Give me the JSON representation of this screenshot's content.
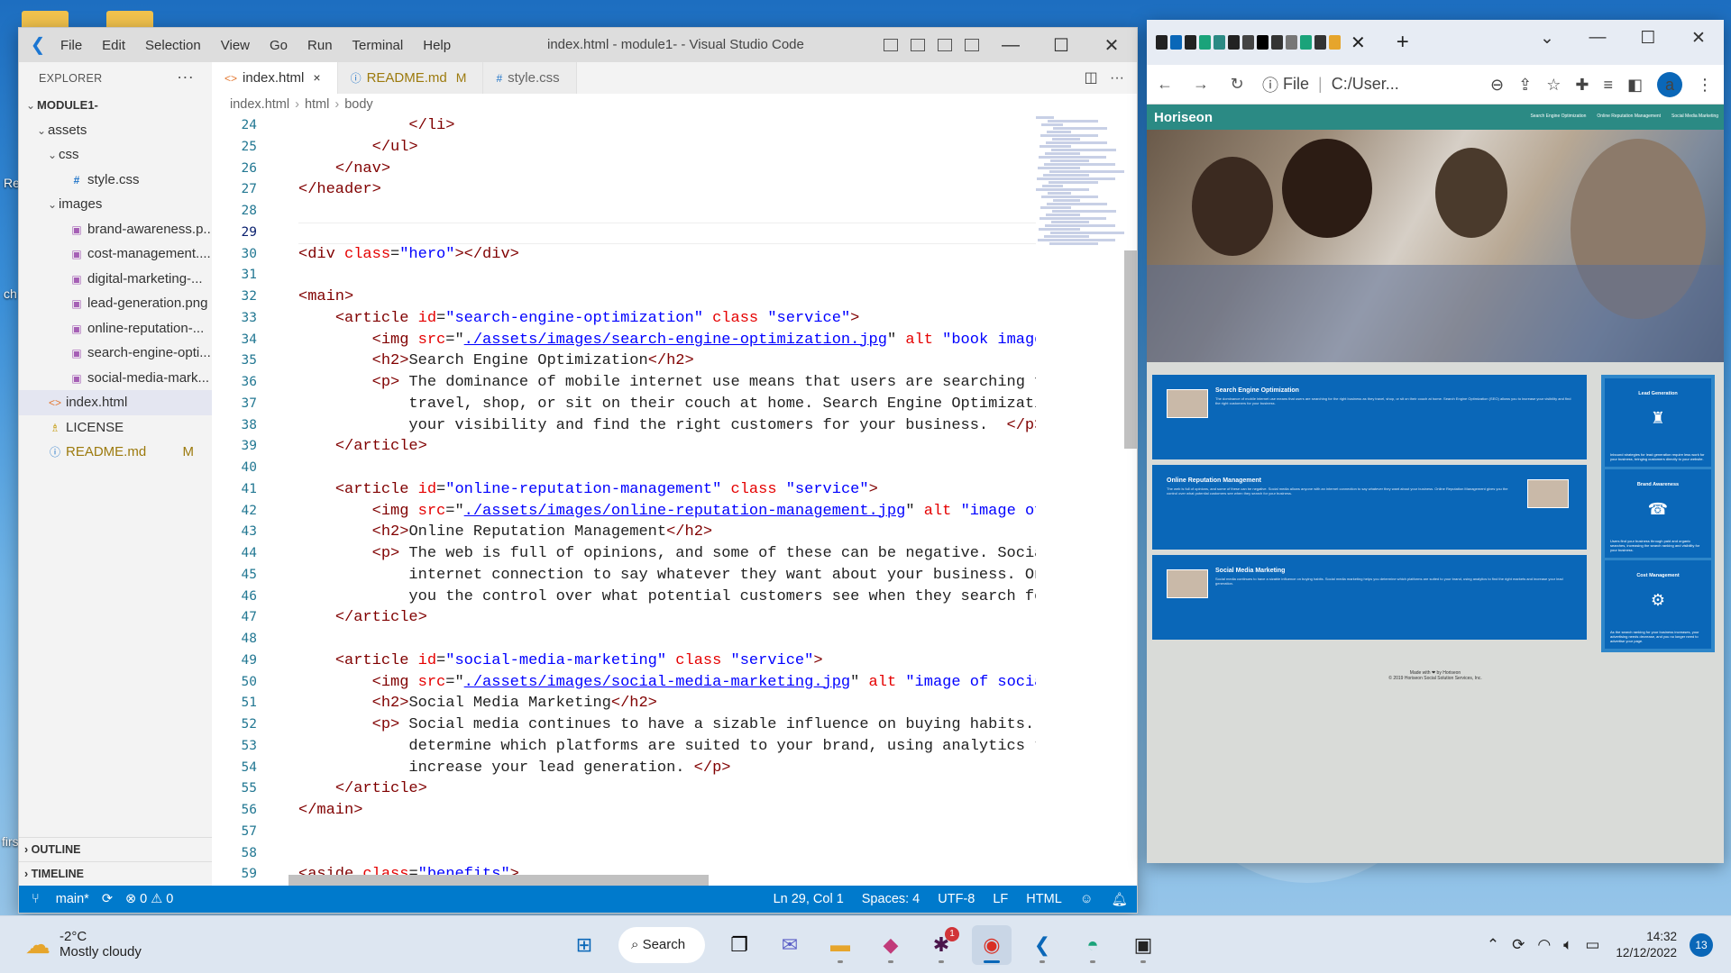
{
  "desktop": {
    "side_texts": [
      "Re",
      "ch",
      "firs"
    ]
  },
  "vscode": {
    "menu": [
      "File",
      "Edit",
      "Selection",
      "View",
      "Go",
      "Run",
      "Terminal",
      "Help"
    ],
    "window_title": "index.html - module1- - Visual Studio Code",
    "explorer_label": "EXPLORER",
    "tree": [
      {
        "label": "MODULE1-",
        "depth": 0,
        "twisty": "⌄",
        "icon": "",
        "kind": "root"
      },
      {
        "label": "assets",
        "depth": 1,
        "twisty": "⌄",
        "icon": "",
        "kind": "folder"
      },
      {
        "label": "css",
        "depth": 2,
        "twisty": "⌄",
        "icon": "",
        "kind": "folder"
      },
      {
        "label": "style.css",
        "depth": 3,
        "twisty": "",
        "icon": "#",
        "kind": "css"
      },
      {
        "label": "images",
        "depth": 2,
        "twisty": "⌄",
        "icon": "",
        "kind": "folder"
      },
      {
        "label": "brand-awareness.p...",
        "depth": 3,
        "twisty": "",
        "icon": "▣",
        "kind": "img"
      },
      {
        "label": "cost-management....",
        "depth": 3,
        "twisty": "",
        "icon": "▣",
        "kind": "img"
      },
      {
        "label": "digital-marketing-...",
        "depth": 3,
        "twisty": "",
        "icon": "▣",
        "kind": "img"
      },
      {
        "label": "lead-generation.png",
        "depth": 3,
        "twisty": "",
        "icon": "▣",
        "kind": "img"
      },
      {
        "label": "online-reputation-...",
        "depth": 3,
        "twisty": "",
        "icon": "▣",
        "kind": "img"
      },
      {
        "label": "search-engine-opti...",
        "depth": 3,
        "twisty": "",
        "icon": "▣",
        "kind": "img"
      },
      {
        "label": "social-media-mark...",
        "depth": 3,
        "twisty": "",
        "icon": "▣",
        "kind": "img"
      },
      {
        "label": "index.html",
        "depth": 1,
        "twisty": "",
        "icon": "<>",
        "kind": "html",
        "selected": true
      },
      {
        "label": "LICENSE",
        "depth": 1,
        "twisty": "",
        "icon": "♗",
        "kind": "lic"
      },
      {
        "label": "README.md",
        "depth": 1,
        "twisty": "",
        "icon": "ⓘ",
        "kind": "info",
        "badge": "M"
      }
    ],
    "outline_label": "OUTLINE",
    "timeline_label": "TIMELINE",
    "tabs": [
      {
        "label": "index.html",
        "icon": "<>",
        "close": "×",
        "active": true
      },
      {
        "label": "README.md",
        "icon": "ⓘ",
        "badge": "M",
        "active": false
      },
      {
        "label": "style.css",
        "icon": "#",
        "active": false
      }
    ],
    "breadcrumb": [
      "index.html",
      "html",
      "body"
    ],
    "line_numbers": [
      "24",
      "25",
      "26",
      "27",
      "28",
      "29",
      "30",
      "31",
      "32",
      "33",
      "34",
      "35",
      "36",
      "37",
      "38",
      "39",
      "40",
      "41",
      "42",
      "43",
      "44",
      "45",
      "46",
      "47",
      "48",
      "49",
      "50",
      "51",
      "52",
      "53",
      "54",
      "55",
      "56",
      "57",
      "58",
      "59"
    ],
    "current_line": "29",
    "code_lines": [
      [
        [
          "            ",
          ""
        ],
        [
          "</li>",
          "t"
        ]
      ],
      [
        [
          "        ",
          ""
        ],
        [
          "</ul>",
          "t"
        ]
      ],
      [
        [
          "    ",
          ""
        ],
        [
          "</nav>",
          "t"
        ]
      ],
      [
        [
          "",
          ""
        ],
        [
          "</header>",
          "t"
        ]
      ],
      [
        [
          "",
          ""
        ]
      ],
      [
        [
          "",
          ""
        ]
      ],
      [
        [
          "",
          ""
        ],
        [
          "<div ",
          "t"
        ],
        [
          "class",
          "a"
        ],
        [
          "=",
          ""
        ],
        [
          "\"hero\"",
          "s"
        ],
        [
          "></div>",
          "t"
        ]
      ],
      [
        [
          "",
          ""
        ]
      ],
      [
        [
          "",
          ""
        ],
        [
          "<main>",
          "t"
        ]
      ],
      [
        [
          "    ",
          ""
        ],
        [
          "<article ",
          "t"
        ],
        [
          "id",
          "a"
        ],
        [
          "=",
          ""
        ],
        [
          "\"search-engine-optimization\"",
          "s"
        ],
        [
          " ",
          ""
        ],
        [
          "class",
          "a"
        ],
        [
          " ",
          ""
        ],
        [
          "\"service\"",
          "s"
        ],
        [
          ">",
          "t"
        ]
      ],
      [
        [
          "        ",
          ""
        ],
        [
          "<img ",
          "t"
        ],
        [
          "src",
          "a"
        ],
        [
          "=\"",
          ""
        ],
        [
          "./assets/images/search-engine-optimization.jpg",
          "u"
        ],
        [
          "\" ",
          ""
        ],
        [
          "alt",
          "a"
        ],
        [
          " ",
          ""
        ],
        [
          "\"book image w",
          "s"
        ]
      ],
      [
        [
          "        ",
          ""
        ],
        [
          "<h2>",
          "t"
        ],
        [
          "Search Engine Optimization",
          ""
        ],
        [
          "</h2>",
          "t"
        ]
      ],
      [
        [
          "        ",
          ""
        ],
        [
          "<p>",
          "t"
        ],
        [
          " The dominance of mobile internet use means that users are searching for",
          ""
        ]
      ],
      [
        [
          "            travel, shop, or sit on their couch at home. Search Engine Optimization",
          ""
        ]
      ],
      [
        [
          "            your visibility and find the right customers for your business.  ",
          ""
        ],
        [
          "</p>",
          "t"
        ]
      ],
      [
        [
          "    ",
          ""
        ],
        [
          "</article>",
          "t"
        ]
      ],
      [
        [
          "",
          ""
        ]
      ],
      [
        [
          "    ",
          ""
        ],
        [
          "<article ",
          "t"
        ],
        [
          "id",
          "a"
        ],
        [
          "=",
          ""
        ],
        [
          "\"online-reputation-management\"",
          "s"
        ],
        [
          " ",
          ""
        ],
        [
          "class",
          "a"
        ],
        [
          " ",
          ""
        ],
        [
          "\"service\"",
          "s"
        ],
        [
          ">",
          "t"
        ]
      ],
      [
        [
          "        ",
          ""
        ],
        [
          "<img ",
          "t"
        ],
        [
          "src",
          "a"
        ],
        [
          "=\"",
          ""
        ],
        [
          "./assets/images/online-reputation-management.jpg",
          "u"
        ],
        [
          "\" ",
          ""
        ],
        [
          "alt",
          "a"
        ],
        [
          " ",
          ""
        ],
        [
          "\"image of m",
          "s"
        ]
      ],
      [
        [
          "        ",
          ""
        ],
        [
          "<h2>",
          "t"
        ],
        [
          "Online Reputation Management",
          ""
        ],
        [
          "</h2>",
          "t"
        ]
      ],
      [
        [
          "        ",
          ""
        ],
        [
          "<p>",
          "t"
        ],
        [
          " The web is full of opinions, and some of these can be negative. Social",
          ""
        ]
      ],
      [
        [
          "            internet connection to say whatever they want about your business. Onli",
          ""
        ]
      ],
      [
        [
          "            you the control over what potential customers see when they search for",
          ""
        ]
      ],
      [
        [
          "    ",
          ""
        ],
        [
          "</article>",
          "t"
        ]
      ],
      [
        [
          "",
          ""
        ]
      ],
      [
        [
          "    ",
          ""
        ],
        [
          "<article ",
          "t"
        ],
        [
          "id",
          "a"
        ],
        [
          "=",
          ""
        ],
        [
          "\"social-media-marketing\"",
          "s"
        ],
        [
          " ",
          ""
        ],
        [
          "class",
          "a"
        ],
        [
          " ",
          ""
        ],
        [
          "\"service\"",
          "s"
        ],
        [
          ">",
          "t"
        ]
      ],
      [
        [
          "        ",
          ""
        ],
        [
          "<img ",
          "t"
        ],
        [
          "src",
          "a"
        ],
        [
          "=\"",
          ""
        ],
        [
          "./assets/images/social-media-marketing.jpg",
          "u"
        ],
        [
          "\" ",
          ""
        ],
        [
          "alt",
          "a"
        ],
        [
          " ",
          ""
        ],
        [
          "\"image of social",
          "s"
        ]
      ],
      [
        [
          "        ",
          ""
        ],
        [
          "<h2>",
          "t"
        ],
        [
          "Social Media Marketing",
          ""
        ],
        [
          "</h2>",
          "t"
        ]
      ],
      [
        [
          "        ",
          ""
        ],
        [
          "<p>",
          "t"
        ],
        [
          " Social media continues to have a sizable influence on buying habits. So",
          ""
        ]
      ],
      [
        [
          "            determine which platforms are suited to your brand, using analytics to",
          ""
        ]
      ],
      [
        [
          "            increase your lead generation. ",
          ""
        ],
        [
          "</p>",
          "t"
        ]
      ],
      [
        [
          "    ",
          ""
        ],
        [
          "</article>",
          "t"
        ]
      ],
      [
        [
          "",
          ""
        ],
        [
          "</main>",
          "t"
        ]
      ],
      [
        [
          "",
          ""
        ]
      ],
      [
        [
          "",
          ""
        ]
      ],
      [
        [
          "",
          ""
        ],
        [
          "<aside ",
          "t"
        ],
        [
          "class",
          "a"
        ],
        [
          "=",
          ""
        ],
        [
          "\"benefits\"",
          "s"
        ],
        [
          ">",
          "t"
        ]
      ]
    ],
    "status": {
      "branch": "main*",
      "errors": "⊗ 0 ⚠ 0",
      "position": "Ln 29, Col 1",
      "spaces": "Spaces: 4",
      "encoding": "UTF-8",
      "eol": "LF",
      "language": "HTML"
    }
  },
  "chrome": {
    "address": "C:/User...",
    "address_prefix": "File",
    "avatar_letter": "a",
    "site": {
      "brand": "Horiseon",
      "nav": [
        "Search Engine Optimization",
        "Online Reputation Management",
        "Social Media Marketing"
      ],
      "services": [
        {
          "title": "Search Engine Optimization",
          "text": "The dominance of mobile internet use means that users are searching for the right business as they travel, shop, or sit on their couch at home. Search Engine Optimization (SEO) allows you to increase your visibility and find the right customers for your business."
        },
        {
          "title": "Online Reputation Management",
          "text": "The web is full of opinions, and some of these can be negative. Social media allows anyone with an internet connection to say whatever they want about your business. Online Reputation Management gives you the control over what potential customers see when they search for your business."
        },
        {
          "title": "Social Media Marketing",
          "text": "Social media continues to have a sizable influence on buying habits. Social media marketing helps you determine which platforms are suited to your brand, using analytics to find the right markets and increase your lead generation."
        }
      ],
      "benefits": [
        {
          "title": "Lead Generation",
          "icon": "♜",
          "text": "Inbound strategies for lead generation require less work for your business, bringing customers directly to your website."
        },
        {
          "title": "Brand Awareness",
          "icon": "☎",
          "text": "Users find your business through paid and organic searches, increasing the search ranking and visibility for your business."
        },
        {
          "title": "Cost Management",
          "icon": "⚙",
          "text": "As the search ranking for your business increases, your advertising needs decrease, and you no longer need to advertise your page."
        }
      ],
      "footer_line1": "Made with ❤ by Horiseon",
      "footer_line2": "© 2019 Horiseon Social Solution Services, Inc."
    }
  },
  "taskbar": {
    "temperature": "-2°C",
    "weather": "Mostly cloudy",
    "search_label": "Search",
    "time": "14:32",
    "date": "12/12/2022",
    "notifications": "13",
    "slack_badge": "1"
  }
}
